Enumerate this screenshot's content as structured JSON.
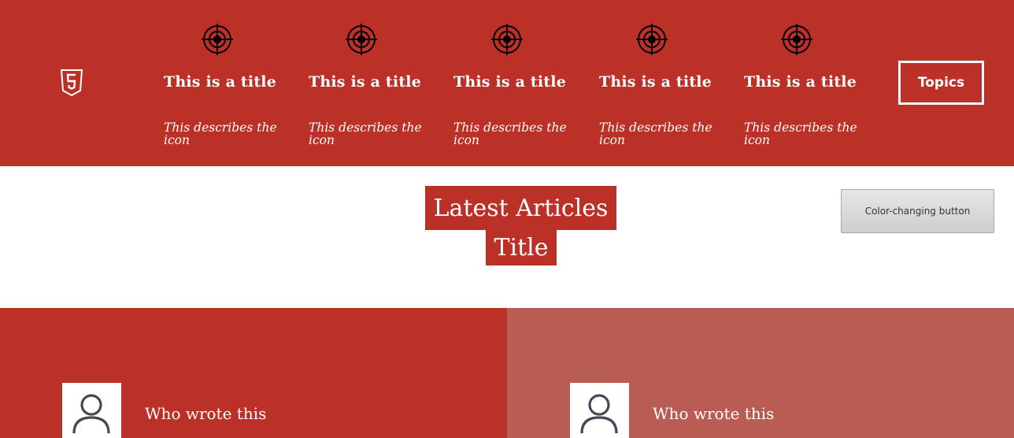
{
  "header": {
    "logo_icon": "html5-icon",
    "features": [
      {
        "icon": "target-icon",
        "title": "This is a title",
        "description": "This describes the icon"
      },
      {
        "icon": "target-icon",
        "title": "This is a title",
        "description": "This describes the icon"
      },
      {
        "icon": "target-icon",
        "title": "This is a title",
        "description": "This describes the icon"
      },
      {
        "icon": "target-icon",
        "title": "This is a title",
        "description": "This describes the icon"
      },
      {
        "icon": "target-icon",
        "title": "This is a title",
        "description": "This describes the icon"
      }
    ],
    "topics_button": "Topics"
  },
  "main": {
    "heading": "Latest Articles",
    "subheading": "Title",
    "color_button": "Color-changing button"
  },
  "articles": [
    {
      "author": "Who wrote this",
      "avatar_icon": "user-icon"
    },
    {
      "author": "Who wrote this",
      "avatar_icon": "user-icon"
    }
  ],
  "colors": {
    "brand_red": "#bb3127",
    "muted_red": "#b85c54",
    "white": "#ffffff"
  }
}
